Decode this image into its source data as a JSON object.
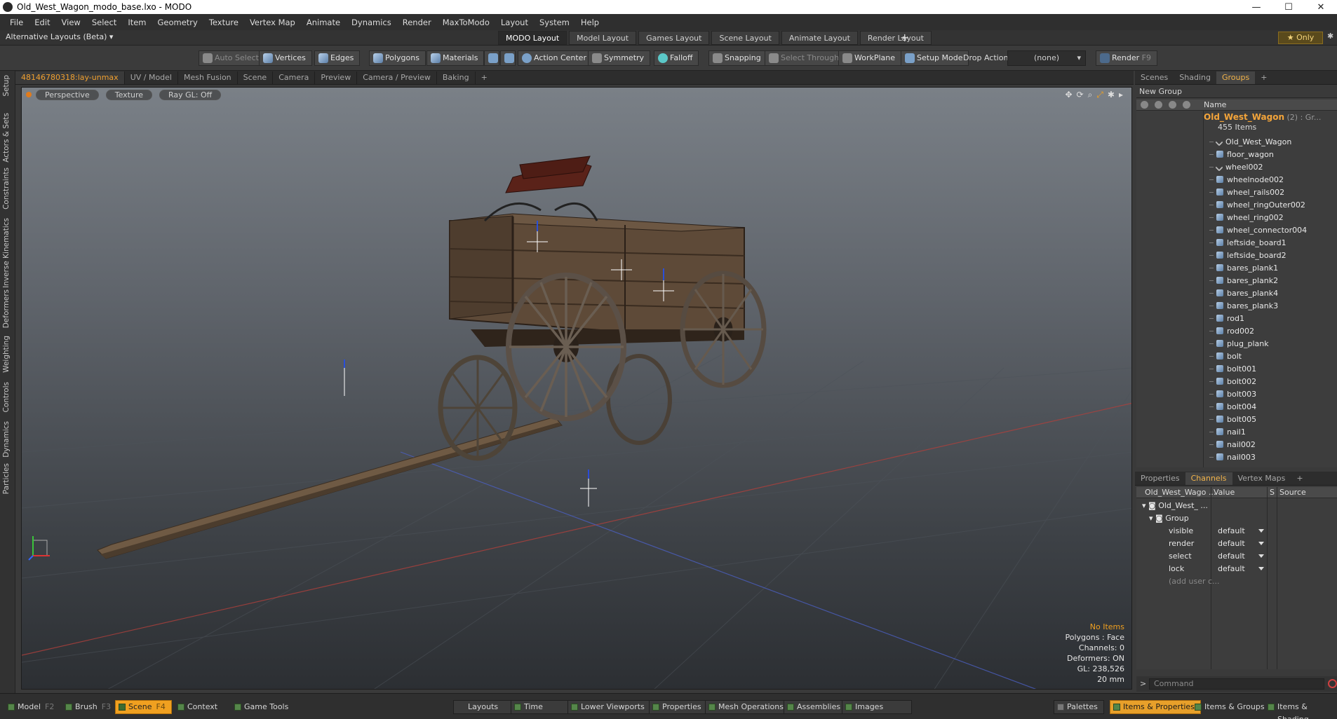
{
  "window": {
    "title": "Old_West_Wagon_modo_base.lxo - MODO",
    "minimize": "—",
    "maximize": "☐",
    "close": "✕"
  },
  "menu": [
    "File",
    "Edit",
    "View",
    "Select",
    "Item",
    "Geometry",
    "Texture",
    "Vertex Map",
    "Animate",
    "Dynamics",
    "Render",
    "MaxToModo",
    "Layout",
    "System",
    "Help"
  ],
  "layoutbar": {
    "alt_layouts": "Alternative Layouts (Beta) ▾",
    "tabs": [
      "MODO Layout",
      "Model Layout",
      "Games Layout",
      "Scene Layout",
      "Animate Layout",
      "Render Layout"
    ],
    "active_tab": "MODO Layout",
    "add": "+",
    "only": "★  Only"
  },
  "toolbar": {
    "auto_select": "Auto Select",
    "vertices": "Vertices",
    "edges": "Edges",
    "polygons": "Polygons",
    "materials": "Materials",
    "action_center": "Action Center",
    "symmetry": "Symmetry",
    "falloff": "Falloff",
    "snapping": "Snapping",
    "select_through": "Select Through",
    "workplane": "WorkPlane",
    "setup_mode": "Setup Mode",
    "drop_action": "Drop Action",
    "drop_value": "(none)",
    "render": "Render",
    "render_key": "F9"
  },
  "leftstrip": [
    "Setup",
    "Actors & Sets",
    "Constraints",
    "Inverse Kinematics",
    "Deformers",
    "Weighting",
    "Controls",
    "Dynamics",
    "Particles"
  ],
  "viewport_tabs": [
    "48146780318:lay-unmax",
    "UV / Model",
    "Mesh Fusion",
    "Scene",
    "Camera",
    "Preview",
    "Camera / Preview",
    "Baking",
    "+"
  ],
  "viewport": {
    "view": "Perspective",
    "shading": "Texture",
    "raygl": "Ray GL: Off",
    "info": {
      "items": "No Items",
      "polygons": "Polygons : Face",
      "channels": "Channels: 0",
      "deformers": "Deformers: ON",
      "gl": "GL: 238,526",
      "scale": "20 mm"
    }
  },
  "right_tabs": [
    "Scenes",
    "Shading",
    "Groups",
    "+"
  ],
  "groups": {
    "new_group": "New Group",
    "name_header": "Name",
    "group_name": "Old_West_Wagon",
    "group_suffix": "(2) : Gr...",
    "group_count": "455 Items",
    "items": [
      "Old_West_Wagon",
      "floor_wagon",
      "wheel002",
      "wheelnode002",
      "wheel_rails002",
      "wheel_ringOuter002",
      "wheel_ring002",
      "wheel_connector004",
      "leftside_board1",
      "leftside_board2",
      "bares_plank1",
      "bares_plank2",
      "bares_plank4",
      "bares_plank3",
      "rod1",
      "rod002",
      "plug_plank",
      "bolt",
      "bolt001",
      "bolt002",
      "bolt003",
      "bolt004",
      "bolt005",
      "nail1",
      "nail002",
      "nail003"
    ],
    "locator_items": [
      "Old_West_Wagon",
      "wheel002"
    ]
  },
  "channel_tabs": [
    "Properties",
    "Channels",
    "Vertex Maps",
    "+"
  ],
  "channels": {
    "headers": {
      "name": "Old_West_Wago ...",
      "value": "Value",
      "s": "S",
      "source": "Source"
    },
    "root": "Old_West_ ...",
    "group": "Group",
    "rows": [
      {
        "name": "visible",
        "value": "default"
      },
      {
        "name": "render",
        "value": "default"
      },
      {
        "name": "select",
        "value": "default"
      },
      {
        "name": "lock",
        "value": "default"
      }
    ],
    "add_user": "(add user c..."
  },
  "command": {
    "prompt": ">",
    "placeholder": "Command"
  },
  "bottombar": {
    "model": "Model",
    "model_key": "F2",
    "brush": "Brush",
    "brush_key": "F3",
    "scene": "Scene",
    "scene_key": "F4",
    "context": "Context",
    "game_tools": "Game Tools",
    "layouts": "Layouts",
    "time": "Time",
    "lower_viewports": "Lower Viewports",
    "properties": "Properties",
    "mesh_operations": "Mesh Operations",
    "assemblies": "Assemblies",
    "images": "Images",
    "palettes": "Palettes",
    "items_properties": "Items & Properties",
    "items_groups": "Items & Groups",
    "items_shading": "Items & Shading"
  },
  "colors": {
    "accent": "#f0a020",
    "group_name": "#f3a43a",
    "selection_ring": "#e07b1c"
  },
  "icons": [
    "app-icon",
    "minimize-icon",
    "maximize-icon",
    "close-icon",
    "cube-icon",
    "locator-icon",
    "gear-icon",
    "eye-icon",
    "lock-icon",
    "record-icon"
  ]
}
